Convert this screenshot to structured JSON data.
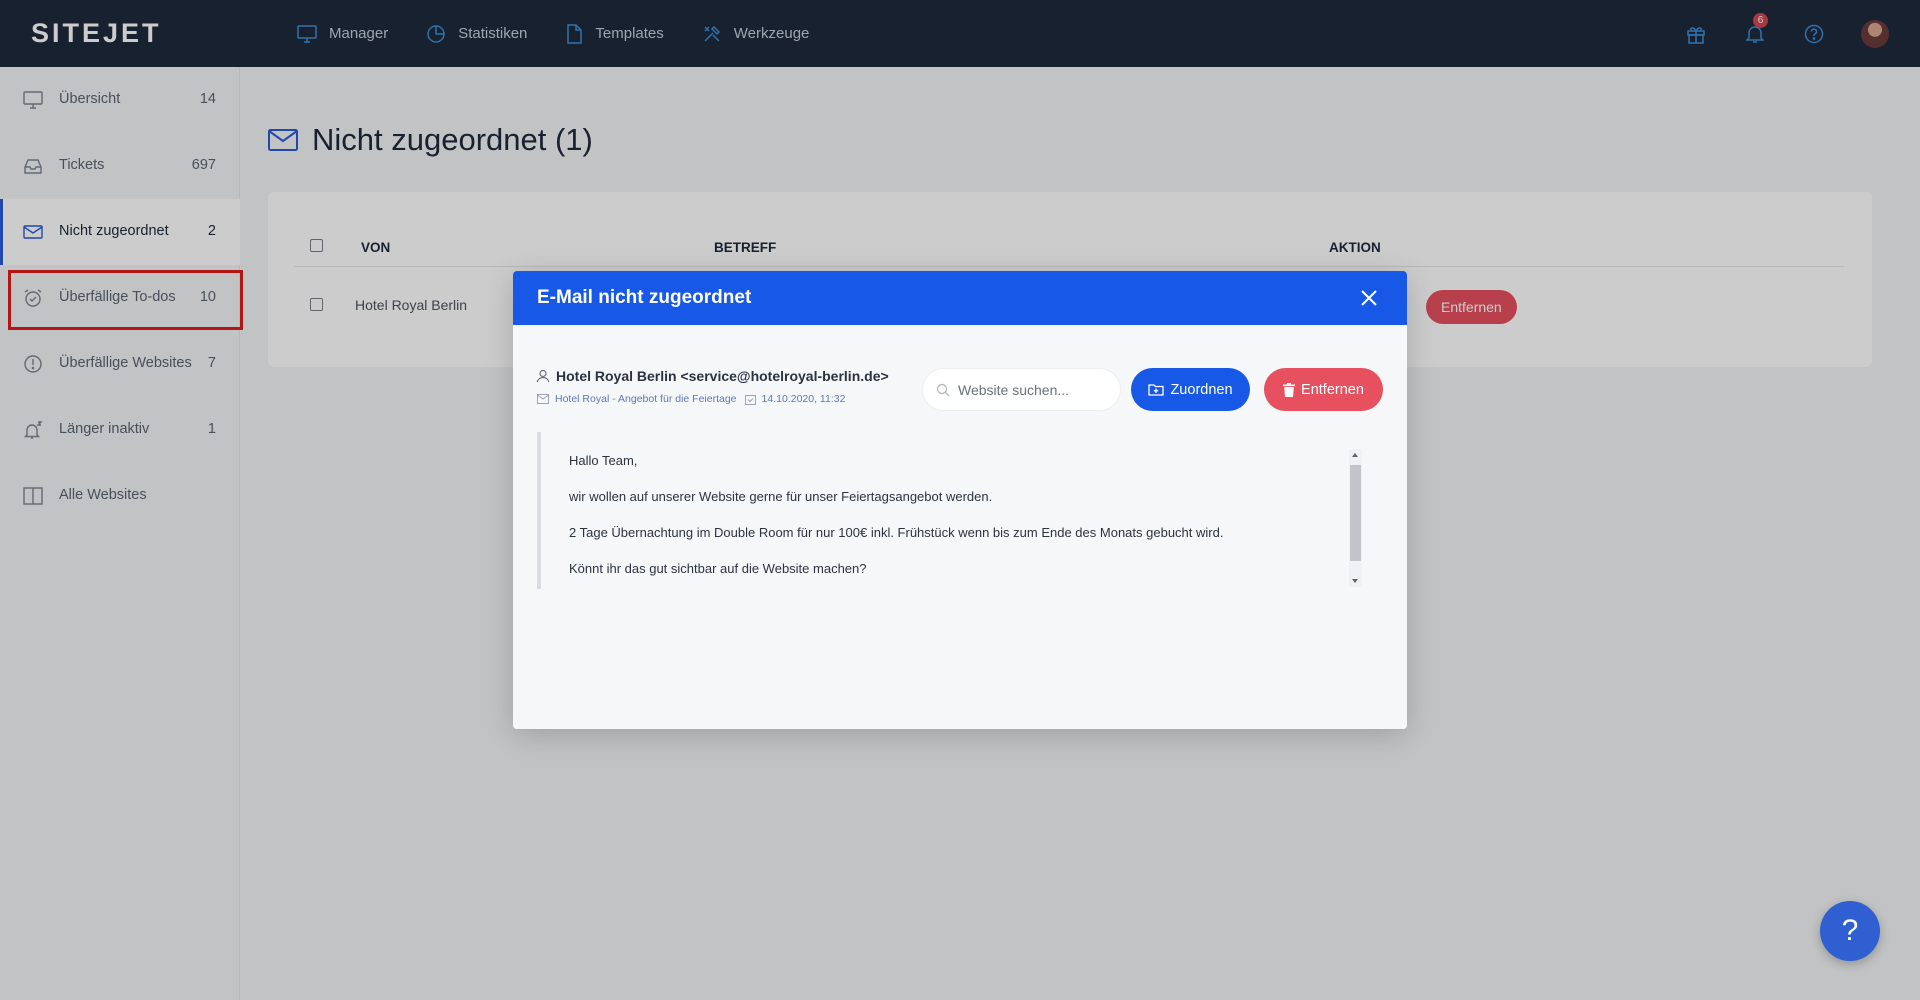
{
  "app": {
    "logo": "SITEJET"
  },
  "topnav": [
    {
      "label": "Manager",
      "icon": "monitor-icon"
    },
    {
      "label": "Statistiken",
      "icon": "pie-chart-icon"
    },
    {
      "label": "Templates",
      "icon": "file-icon"
    },
    {
      "label": "Werkzeuge",
      "icon": "tools-icon"
    }
  ],
  "top_right": {
    "notification_count": "6",
    "icons": [
      "gift-icon",
      "bell-icon",
      "help-circle-icon",
      "avatar"
    ]
  },
  "sidebar": {
    "items": [
      {
        "label": "Übersicht",
        "count": "14",
        "icon": "monitor-icon"
      },
      {
        "label": "Tickets",
        "count": "697",
        "icon": "inbox-icon"
      },
      {
        "label": "Nicht zugeordnet",
        "count": "2",
        "icon": "envelope-icon",
        "active": true
      },
      {
        "label": "Überfällige To-dos",
        "count": "10",
        "icon": "alarm-icon"
      },
      {
        "label": "Überfällige Websites",
        "count": "7",
        "icon": "alert-circle-icon"
      },
      {
        "label": "Länger inaktiv",
        "count": "1",
        "icon": "bell-sleep-icon"
      },
      {
        "label": "Alle Websites",
        "count": "",
        "icon": "columns-icon"
      }
    ]
  },
  "page": {
    "title": "Nicht zugeordnet (1)"
  },
  "table": {
    "headers": {
      "from": "VON",
      "subject": "BETREFF",
      "action": "AKTION"
    },
    "rows": [
      {
        "from": "Hotel Royal Berlin",
        "remove_label": "Entfernen"
      }
    ]
  },
  "modal": {
    "title": "E-Mail nicht zugeordnet",
    "sender": "Hotel Royal Berlin <service@hotelroyal-berlin.de>",
    "subject": "Hotel Royal - Angebot für die Feiertage",
    "date": "14.10.2020, 11:32",
    "search_placeholder": "Website suchen...",
    "assign_label": "Zuordnen",
    "remove_label": "Entfernen",
    "body": [
      "Hallo Team,",
      "wir wollen auf unserer Website gerne für unser Feiertagsangebot werden.",
      "2 Tage Übernachtung im Double Room für nur 100€ inkl. Frühstück wenn bis zum Ende des Monats gebucht wird.",
      "Könnt ihr das gut sichtbar auf die Website machen?"
    ]
  },
  "help": {
    "label": "?"
  },
  "colors": {
    "topbar": "#1f2a3b",
    "primary": "#1759e6",
    "danger": "#e7505f",
    "highlight": "#e21c1c"
  }
}
